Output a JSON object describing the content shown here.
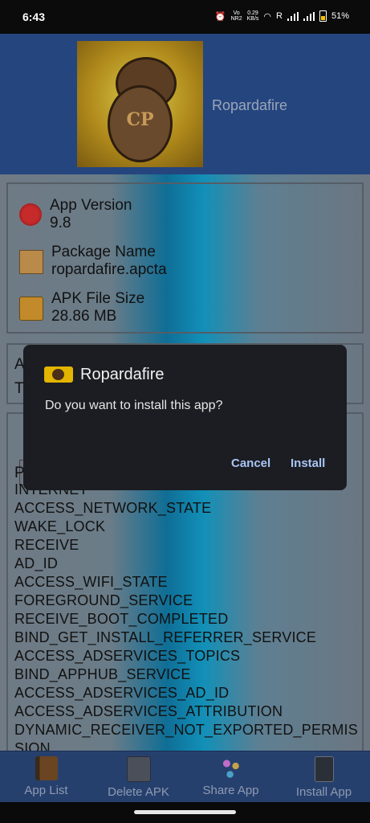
{
  "status_bar": {
    "time": "6:43",
    "volte_top": "Vo",
    "volte_bottom": "NR2",
    "speed_top": "0.29",
    "speed_bottom": "KB/s",
    "roaming": "R",
    "battery": "51%"
  },
  "header": {
    "app_name": "Ropardafire",
    "icon_text": "CP"
  },
  "app_info": [
    {
      "label": "App Version",
      "value": "9.8",
      "icon": "ribbon-icon"
    },
    {
      "label": "Package Name",
      "value": "ropardafire.apcta",
      "icon": "package-icon"
    },
    {
      "label": "APK File Size",
      "value": "28.86 MB",
      "icon": "file-icon"
    }
  ],
  "partial_card": {
    "line1": "A",
    "line2": "T"
  },
  "permissions": {
    "partial_top1": "P",
    "items": [
      "INTERNET",
      "ACCESS_NETWORK_STATE",
      "WAKE_LOCK",
      "RECEIVE",
      "AD_ID",
      "ACCESS_WIFI_STATE",
      "FOREGROUND_SERVICE",
      "RECEIVE_BOOT_COMPLETED",
      "BIND_GET_INSTALL_REFERRER_SERVICE",
      "ACCESS_ADSERVICES_TOPICS",
      "BIND_APPHUB_SERVICE",
      "ACCESS_ADSERVICES_AD_ID",
      "ACCESS_ADSERVICES_ATTRIBUTION",
      "DYNAMIC_RECEIVER_NOT_EXPORTED_PERMIS",
      "SION"
    ]
  },
  "dialog": {
    "title": "Ropardafire",
    "message": "Do you want to install this app?",
    "cancel_label": "Cancel",
    "install_label": "Install"
  },
  "bottom_nav": [
    {
      "label": "App List",
      "icon": "book-icon"
    },
    {
      "label": "Delete APK",
      "icon": "printer-icon"
    },
    {
      "label": "Share App",
      "icon": "share-icon"
    },
    {
      "label": "Install App",
      "icon": "phone-icon"
    }
  ],
  "colors": {
    "dialog_bg": "#1c1d22",
    "dialog_button": "#a8c5f5",
    "header_bg": "#25457f",
    "nav_bg": "#26406e"
  }
}
